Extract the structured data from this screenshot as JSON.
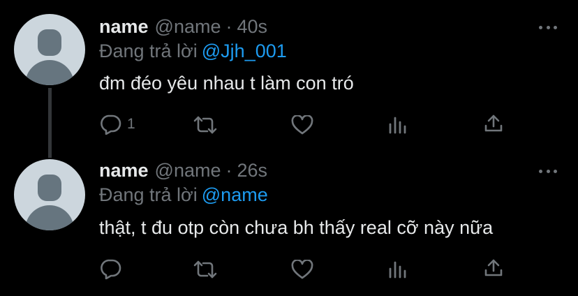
{
  "tweets": [
    {
      "name": "name",
      "handle": "@name",
      "separator": "·",
      "time": "40s",
      "replying_label": "Đang trả lời",
      "replying_to": "@Jjh_001",
      "text": "đm đéo yêu nhau t làm con tró",
      "actions": {
        "reply_count": "1",
        "retweet_count": "",
        "like_count": ""
      }
    },
    {
      "name": "name",
      "handle": "@name",
      "separator": "·",
      "time": "26s",
      "replying_label": "Đang trả lời",
      "replying_to": "@name",
      "text": "thật, t đu otp còn chưa bh thấy real cỡ này nữa",
      "actions": {
        "reply_count": "",
        "retweet_count": "",
        "like_count": ""
      }
    }
  ],
  "icons": {
    "reply": "reply-icon",
    "retweet": "retweet-icon",
    "like": "heart-icon",
    "views": "analytics-icon",
    "share": "share-icon",
    "more": "more-icon"
  },
  "colors": {
    "background": "#000000",
    "primary_text": "#e7e9ea",
    "secondary_text": "#71767b",
    "link": "#1d9bf0",
    "avatar_bg": "#ccd6dd",
    "avatar_fg": "#66757f",
    "thread_line": "#333639"
  }
}
